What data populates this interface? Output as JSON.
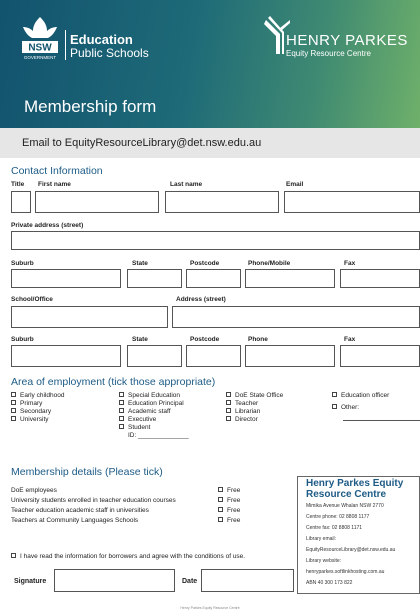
{
  "header": {
    "nsw_label": "NSW",
    "nsw_sub": "GOVERNMENT",
    "edu_title": "Education",
    "edu_sub": "Public Schools",
    "hp_title": "HENRY PARKES",
    "hp_sub": "Equity Resource Centre",
    "form_title": "Membership form"
  },
  "email_line": "Email to EquityResourceLibrary@det.nsw.edu.au",
  "contact": {
    "heading": "Contact Information",
    "title_label": "Title",
    "first_name_label": "First name",
    "last_name_label": "Last name",
    "email_label": "Email",
    "private_address_label": "Private address (street)",
    "suburb_label": "Suburb",
    "state_label": "State",
    "postcode_label": "Postcode",
    "phone_mobile_label": "Phone/Mobile",
    "fax_label": "Fax",
    "school_label": "School/Office",
    "address_street_label": "Address (street)",
    "suburb2_label": "Suburb",
    "state2_label": "State",
    "postcode2_label": "Postcode",
    "phone_label": "Phone",
    "fax2_label": "Fax"
  },
  "employment": {
    "heading": "Area of employment (tick those appropriate)",
    "col1": [
      "Early childhood",
      "Primary",
      "Secondary",
      "University"
    ],
    "col2": [
      "Special Education",
      "Education Principal",
      "Academic staff",
      "Executive",
      "Student"
    ],
    "id_label": "ID: ______________",
    "col3": [
      "DoE State Office",
      "Teacher",
      "Librarian",
      "Director"
    ],
    "col4": [
      "Education officer",
      "Other:"
    ]
  },
  "membership": {
    "heading": "Membership details (Please tick)",
    "rows": [
      {
        "label": "DoE employees",
        "fee": "Free"
      },
      {
        "label": "University students enrolled in teacher education courses",
        "fee": "Free"
      },
      {
        "label": "Teacher education academic staff in universities",
        "fee": "Free"
      },
      {
        "label": "Teachers at Community Languages Schools",
        "fee": "Free"
      }
    ]
  },
  "info_box": {
    "title_line1": "Henry Parkes Equity",
    "title_line2": "Resource Centre",
    "lines": [
      "Mimika Avenue Whalan NSW 2770",
      "Centre phone: 02 8808 1177",
      "Centre fax: 02 8808 1171",
      "Library email:",
      "EquityResourceLibrary@det.nsw.edu.au",
      "Library website:",
      "henryparkes.softlinkhosting.com.au",
      "ABN 40 300 173 822"
    ]
  },
  "agreement": "I have read the information for borrowers and agree with the conditions of use.",
  "signature_label": "Signature",
  "date_label": "Date",
  "footer": "Henry Parkes Equity Resource Centre"
}
